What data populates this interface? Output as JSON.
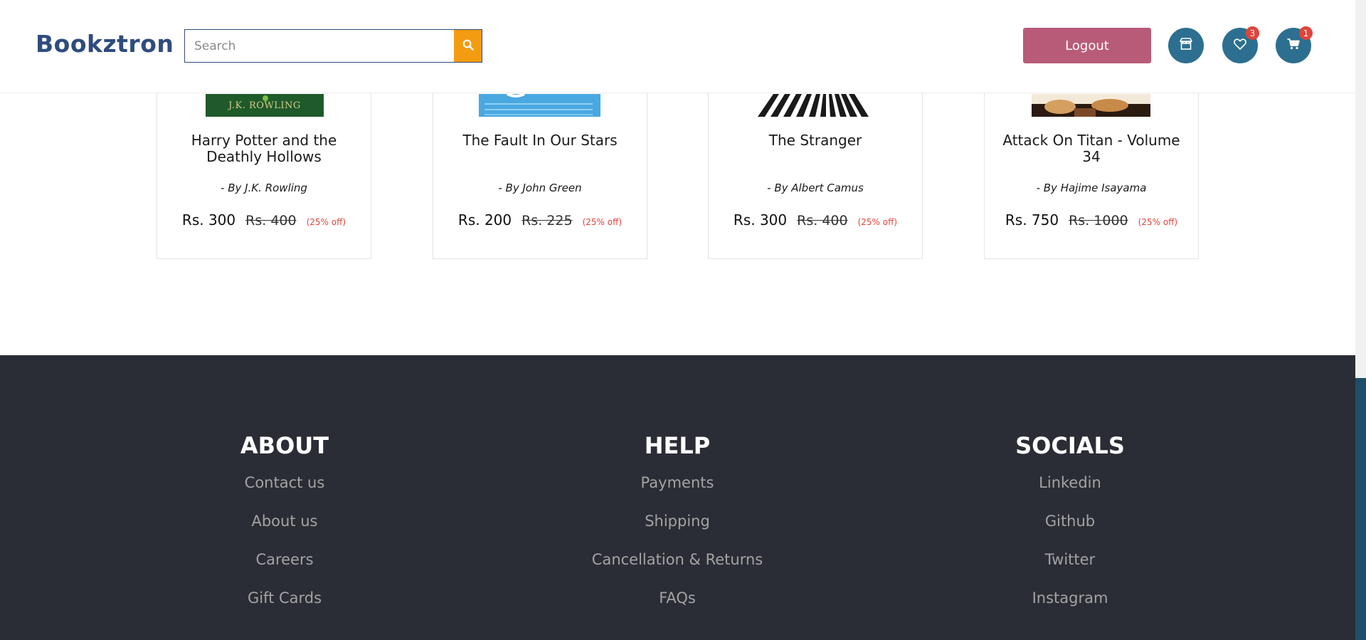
{
  "header": {
    "logo": "Bookztron",
    "search_placeholder": "Search",
    "logout_label": "Logout",
    "wishlist_count": "3",
    "cart_count": "1"
  },
  "books": [
    {
      "title": "Harry Potter and the Deathly Hollows",
      "author": "- By  J.K. Rowling",
      "cover_text": "J.K. ROWLING",
      "price": "Rs. 300",
      "original_price": "Rs. 400",
      "discount": "(25% off)"
    },
    {
      "title": "The Fault In Our Stars",
      "author": "- By  John Green",
      "cover_text": "",
      "price": "Rs. 200",
      "original_price": "Rs. 225",
      "discount": "(25% off)"
    },
    {
      "title": "The Stranger",
      "author": "- By  Albert Camus",
      "cover_text": "",
      "price": "Rs. 300",
      "original_price": "Rs. 400",
      "discount": "(25% off)"
    },
    {
      "title": "Attack On Titan - Volume 34",
      "author": "- By  Hajime Isayama",
      "cover_text": "",
      "price": "Rs. 750",
      "original_price": "Rs. 1000",
      "discount": "(25% off)"
    }
  ],
  "footer": {
    "about": {
      "heading": "ABOUT",
      "links": [
        "Contact us",
        "About us",
        "Careers",
        "Gift Cards"
      ]
    },
    "help": {
      "heading": "HELP",
      "links": [
        "Payments",
        "Shipping",
        "Cancellation & Returns",
        "FAQs"
      ]
    },
    "socials": {
      "heading": "SOCIALS",
      "links": [
        "Linkedin",
        "Github",
        "Twitter",
        "Instagram"
      ]
    }
  },
  "colors": {
    "brand": "#2f4c7e",
    "search_button": "#f39c12",
    "logout": "#b85b78",
    "icon_button": "#2d6f90",
    "badge": "#e0443a",
    "footer_bg": "#2b2d36"
  },
  "icons": {
    "search": "search-icon",
    "store": "store-icon",
    "wishlist": "heart-icon",
    "cart": "cart-icon"
  }
}
